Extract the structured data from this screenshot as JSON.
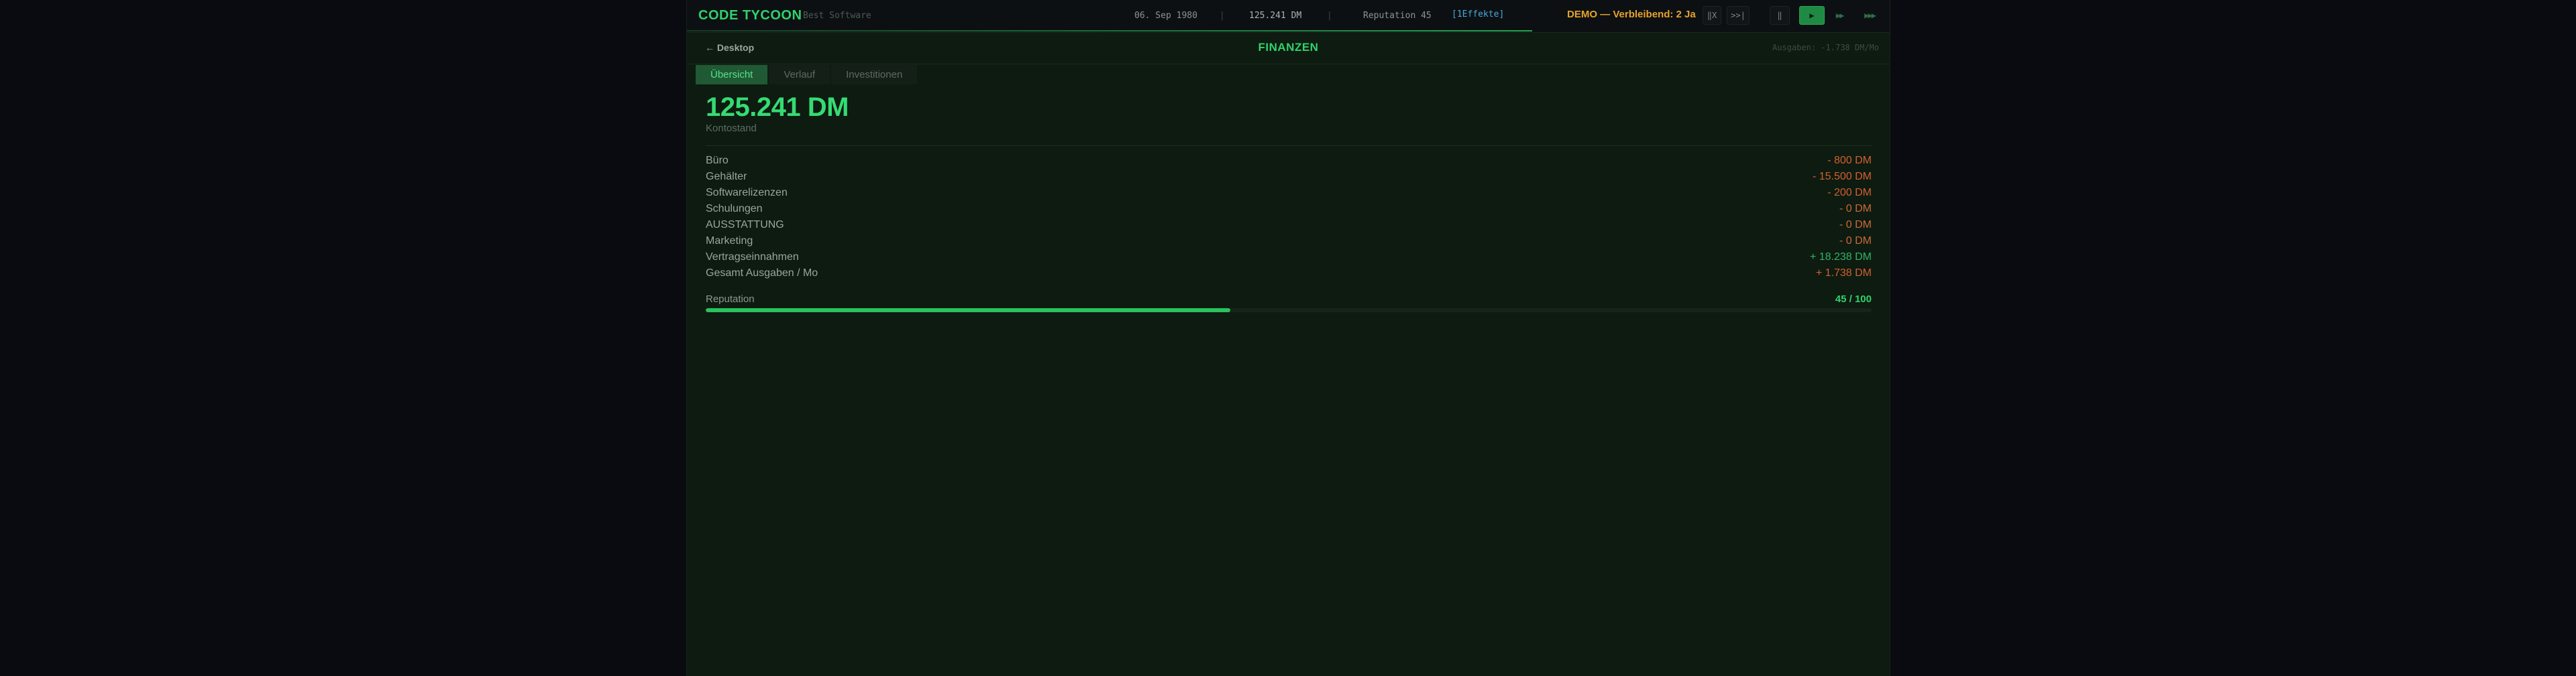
{
  "topbar": {
    "brand": "CODE TYCOON",
    "company": "Best Software",
    "date": "06. Sep 1980",
    "balance": "125.241 DM",
    "reputation": "Reputation 45",
    "effects": "[1Effekte]",
    "demo": "DEMO — Verbleibend: 2 Ja",
    "controls": {
      "pause_label": "‖X",
      "skip_label": ">>|",
      "stop_label": "‖",
      "play_label": "▶",
      "speed2_label": "▶▶",
      "speed3_label": "▶▶▶"
    }
  },
  "subheader": {
    "back_label": "← Desktop",
    "title": "FINANZEN",
    "expense_rate": "Ausgaben: -1.738 DM/Mo"
  },
  "tabs": [
    {
      "label": "Übersicht",
      "active": true
    },
    {
      "label": "Verlauf",
      "active": false
    },
    {
      "label": "Investitionen",
      "active": false
    }
  ],
  "overview": {
    "balance": "125.241 DM",
    "balance_label": "Kontostand",
    "rows": [
      {
        "label": "Büro",
        "value": "- 800 DM",
        "kind": "neg"
      },
      {
        "label": "Gehälter",
        "value": "- 15.500 DM",
        "kind": "neg"
      },
      {
        "label": "Softwarelizenzen",
        "value": "- 200 DM",
        "kind": "neg"
      },
      {
        "label": "Schulungen",
        "value": "- 0 DM",
        "kind": "neg0"
      },
      {
        "label": "AUSSTATTUNG",
        "value": "- 0 DM",
        "kind": "neg0"
      },
      {
        "label": "Marketing",
        "value": "- 0 DM",
        "kind": "neg0"
      },
      {
        "label": "Vertragseinnahmen",
        "value": "+ 18.238 DM",
        "kind": "pos"
      },
      {
        "label": "Gesamt Ausgaben / Mo",
        "value": "+ 1.738 DM",
        "kind": "neg"
      }
    ],
    "reputation": {
      "label": "Reputation",
      "value_text": "45 / 100",
      "fraction": 0.45
    }
  },
  "colors": {
    "accent": "#2fd26c",
    "negative": "#d2602f",
    "positive": "#2fb466",
    "demo": "#e6a32a",
    "effects": "#4aa8d8"
  }
}
